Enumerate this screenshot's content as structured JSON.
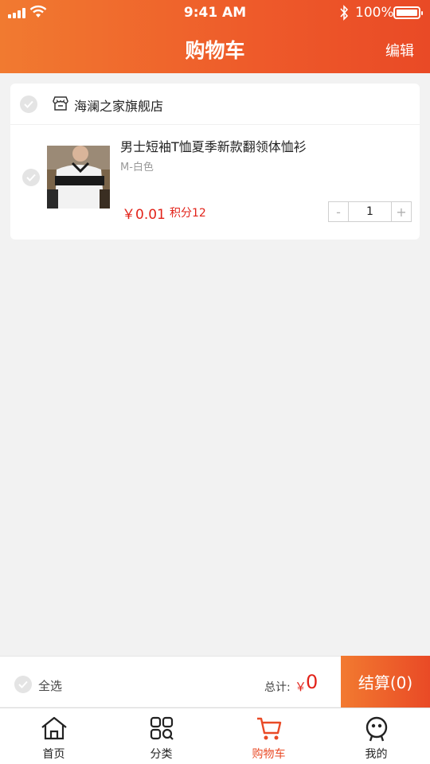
{
  "status_bar": {
    "time": "9:41 AM",
    "battery": "100%"
  },
  "header": {
    "title": "购物车",
    "edit_label": "编辑"
  },
  "shop": {
    "name": "海澜之家旗舰店"
  },
  "item": {
    "title": "男士短袖T恤夏季新款翻领体恤衫",
    "variant": "M-白色",
    "price": "￥0.01",
    "points": "积分12",
    "quantity": "1",
    "minus": "-",
    "plus": "+"
  },
  "checkout": {
    "select_all_label": "全选",
    "total_label": "总计:",
    "currency": "￥",
    "total_value": "0",
    "checkout_label": "结算(0)"
  },
  "tabbar": {
    "tabs": [
      {
        "label": "首页",
        "icon": "home-icon"
      },
      {
        "label": "分类",
        "icon": "category-icon"
      },
      {
        "label": "购物车",
        "icon": "cart-icon",
        "active": true
      },
      {
        "label": "我的",
        "icon": "profile-icon"
      }
    ]
  },
  "colors": {
    "accent": "#e94a26",
    "price": "#e2231a",
    "background": "#f2f2f2"
  }
}
